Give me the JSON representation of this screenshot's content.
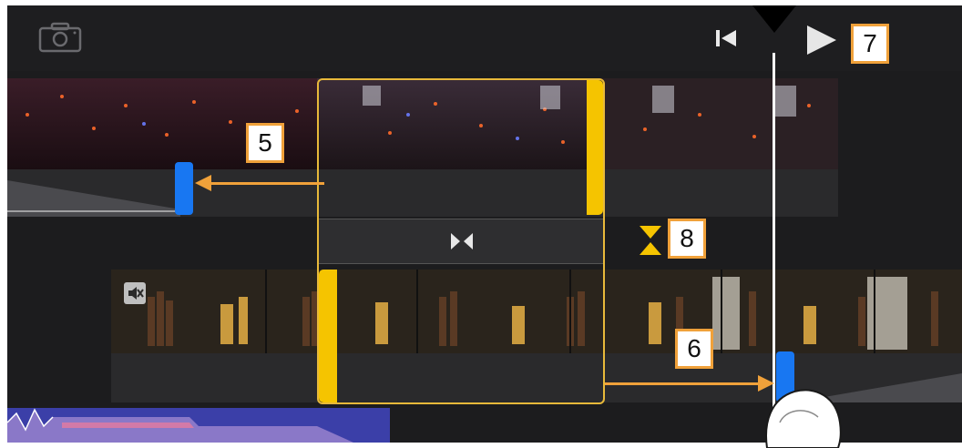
{
  "toolbar": {
    "camera_icon": "camera-icon",
    "skip_back_icon": "skip-to-start-icon",
    "play_icon": "play-icon"
  },
  "callouts": {
    "c5": "5",
    "c6": "6",
    "c7": "7",
    "c8": "8"
  },
  "colors": {
    "background": "#1c1c1e",
    "selection": "#e8b93a",
    "trim_handle": "#f5c400",
    "blue_handle": "#1877f2",
    "callout_border": "#f0a13a",
    "arrow": "#f0a13a"
  },
  "icons": {
    "mute": "mute-icon",
    "transition": "transition-icon",
    "transition_adjust": "transition-adjust-icon",
    "finger": "finger-tap-icon"
  }
}
